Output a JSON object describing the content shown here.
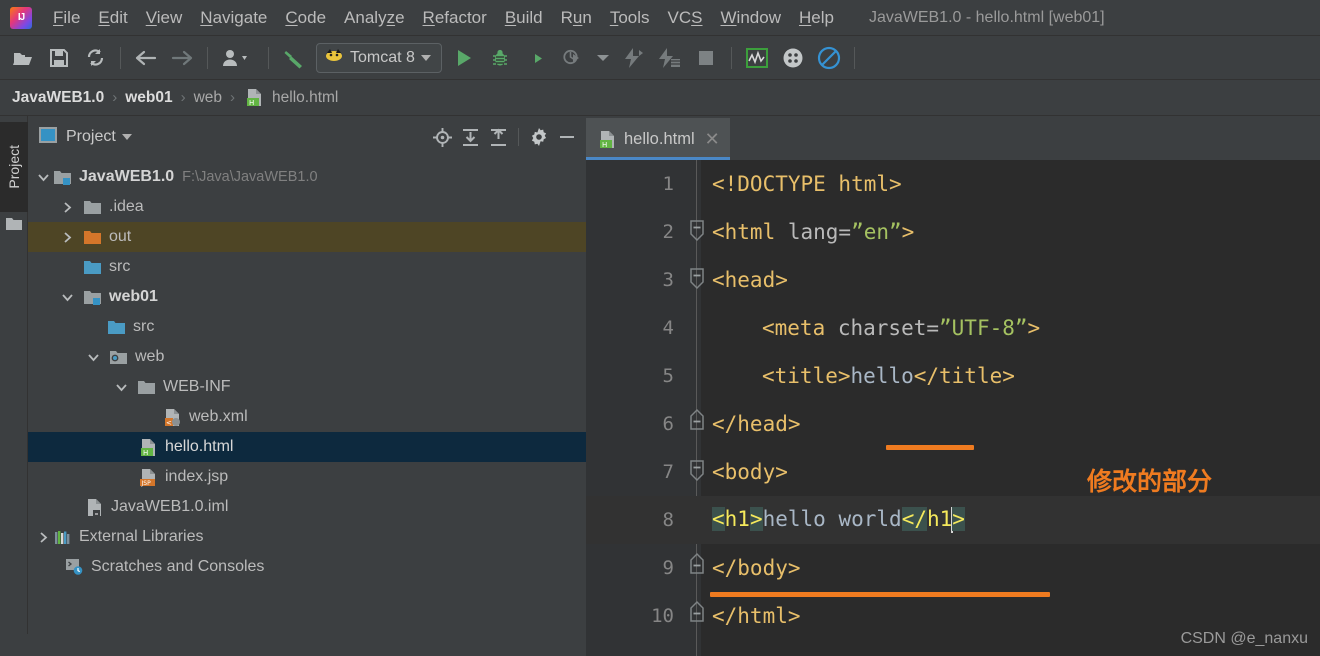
{
  "window": {
    "title": "JavaWEB1.0 - hello.html [web01]",
    "logo_icon": "intellij-idea-logo"
  },
  "menubar": {
    "items": [
      {
        "label": "File",
        "mnemonic": "F"
      },
      {
        "label": "Edit",
        "mnemonic": "E"
      },
      {
        "label": "View",
        "mnemonic": "V"
      },
      {
        "label": "Navigate",
        "mnemonic": "N"
      },
      {
        "label": "Code",
        "mnemonic": "C"
      },
      {
        "label": "Analyze",
        "mnemonic": "y"
      },
      {
        "label": "Refactor",
        "mnemonic": "R"
      },
      {
        "label": "Build",
        "mnemonic": "B"
      },
      {
        "label": "Run",
        "mnemonic": "u"
      },
      {
        "label": "Tools",
        "mnemonic": "T"
      },
      {
        "label": "VCS",
        "mnemonic": "S"
      },
      {
        "label": "Window",
        "mnemonic": "W"
      },
      {
        "label": "Help",
        "mnemonic": "H"
      }
    ]
  },
  "toolbar": {
    "buttons": [
      {
        "icon": "open-folder-icon",
        "name": "open-project-button"
      },
      {
        "icon": "save-icon",
        "name": "save-all-button"
      },
      {
        "icon": "sync-icon",
        "name": "synchronize-button"
      },
      {
        "icon": "arrow-left-icon",
        "name": "back-button"
      },
      {
        "icon": "arrow-right-icon",
        "name": "forward-button"
      },
      {
        "icon": "person-dropdown-icon",
        "name": "user-menu-button"
      },
      {
        "icon": "hammer-icon",
        "name": "build-project-button"
      }
    ],
    "run_config": {
      "label": "Tomcat 8",
      "icon": "tomcat-icon",
      "dropdown_icon": "chevron-down-icon"
    },
    "run_buttons": [
      {
        "icon": "play-icon",
        "name": "run-button"
      },
      {
        "icon": "bug-icon",
        "name": "debug-button"
      },
      {
        "icon": "coverage-icon",
        "name": "run-with-coverage-button"
      },
      {
        "icon": "profiler-icon",
        "name": "profile-button"
      },
      {
        "icon": "chevron-down-icon",
        "name": "profile-dropdown-button"
      },
      {
        "icon": "update-app-icon",
        "name": "update-application-button"
      },
      {
        "icon": "redeploy-icon",
        "name": "redeploy-button"
      },
      {
        "icon": "stop-icon",
        "name": "stop-button"
      }
    ],
    "right_buttons": [
      {
        "icon": "monitor-chart-icon",
        "name": "monitor-button"
      },
      {
        "icon": "dots-grid-icon",
        "name": "browse-button"
      },
      {
        "icon": "no-entry-icon",
        "name": "disable-button"
      }
    ]
  },
  "breadcrumb": {
    "items": [
      {
        "label": "JavaWEB1.0",
        "strong": true
      },
      {
        "label": "web01",
        "strong": true
      },
      {
        "label": "web",
        "strong": false
      },
      {
        "label": "hello.html",
        "strong": false,
        "icon": "html-file-icon"
      }
    ],
    "separator": "›"
  },
  "left_strip": {
    "tab_label": "Project",
    "icon": "folder-icon"
  },
  "project_panel": {
    "title": "Project",
    "dropdown_icon": "chevron-down-icon",
    "actions": [
      {
        "icon": "locate-target-icon",
        "name": "select-opened-file-button"
      },
      {
        "icon": "expand-all-icon",
        "name": "expand-all-button"
      },
      {
        "icon": "collapse-all-icon",
        "name": "collapse-all-button"
      },
      {
        "icon": "gear-icon",
        "name": "settings-button"
      },
      {
        "icon": "minimize-icon",
        "name": "hide-button"
      }
    ],
    "tree": [
      {
        "label": "JavaWEB1.0",
        "sublabel": "F:\\Java\\JavaWEB1.0",
        "indent": 0,
        "twisty": "expanded",
        "icon": "module-folder-icon",
        "bold": true,
        "selected": "none"
      },
      {
        "label": ".idea",
        "sublabel": "",
        "indent": 1,
        "twisty": "collapsed",
        "icon": "folder-gray-icon",
        "bold": false,
        "selected": "none"
      },
      {
        "label": "out",
        "sublabel": "",
        "indent": 1,
        "twisty": "collapsed",
        "icon": "folder-orange-icon",
        "bold": false,
        "selected": "brown"
      },
      {
        "label": "src",
        "sublabel": "",
        "indent": 1,
        "twisty": "none",
        "icon": "folder-source-icon",
        "bold": false,
        "selected": "none"
      },
      {
        "label": "web01",
        "sublabel": "",
        "indent": 1,
        "twisty": "expanded",
        "icon": "module-folder-icon",
        "bold": true,
        "selected": "none"
      },
      {
        "label": "src",
        "sublabel": "",
        "indent": 2,
        "twisty": "none",
        "icon": "folder-source-icon",
        "bold": false,
        "selected": "none"
      },
      {
        "label": "web",
        "sublabel": "",
        "indent": 2,
        "twisty": "expanded",
        "icon": "folder-web-icon",
        "bold": false,
        "selected": "none"
      },
      {
        "label": "WEB-INF",
        "sublabel": "",
        "indent": 3,
        "twisty": "expanded",
        "icon": "folder-gray-icon",
        "bold": false,
        "selected": "none"
      },
      {
        "label": "web.xml",
        "sublabel": "",
        "indent": 4,
        "twisty": "none",
        "icon": "xml-file-icon",
        "bold": false,
        "selected": "none"
      },
      {
        "label": "hello.html",
        "sublabel": "",
        "indent": 3,
        "twisty": "none",
        "icon": "html-file-icon",
        "bold": false,
        "selected": "blue"
      },
      {
        "label": "index.jsp",
        "sublabel": "",
        "indent": 3,
        "twisty": "none",
        "icon": "jsp-file-icon",
        "bold": false,
        "selected": "none"
      },
      {
        "label": "JavaWEB1.0.iml",
        "sublabel": "",
        "indent": 1,
        "twisty": "none",
        "icon": "iml-file-icon",
        "bold": false,
        "selected": "none"
      },
      {
        "label": "External Libraries",
        "sublabel": "",
        "indent": 0,
        "twisty": "collapsed",
        "icon": "libraries-icon",
        "bold": false,
        "selected": "none"
      },
      {
        "label": "Scratches and Consoles",
        "sublabel": "",
        "indent": 0,
        "twisty": "none",
        "icon": "scratches-icon",
        "bold": false,
        "selected": "none"
      }
    ]
  },
  "editor": {
    "tab": {
      "label": "hello.html",
      "icon": "html-file-icon",
      "close_icon": "close-icon"
    },
    "lines": [
      {
        "num": "1",
        "fold": "none",
        "caret_line": false
      },
      {
        "num": "2",
        "fold": "open",
        "caret_line": false
      },
      {
        "num": "3",
        "fold": "open",
        "caret_line": false
      },
      {
        "num": "4",
        "fold": "none",
        "caret_line": false
      },
      {
        "num": "5",
        "fold": "none",
        "caret_line": false
      },
      {
        "num": "6",
        "fold": "close",
        "caret_line": false
      },
      {
        "num": "7",
        "fold": "open",
        "caret_line": false
      },
      {
        "num": "8",
        "fold": "none",
        "caret_line": true
      },
      {
        "num": "9",
        "fold": "close",
        "caret_line": false
      },
      {
        "num": "10",
        "fold": "close",
        "caret_line": false
      }
    ],
    "code": {
      "l1_tag": "<!DOCTYPE html>",
      "l2_a": "<html",
      "l2_b": " lang=",
      "l2_c": "”en”",
      "l2_d": ">",
      "l3": "<head>",
      "l4_a": "<meta",
      "l4_b": " charset=",
      "l4_c": "”UTF-8”",
      "l4_d": ">",
      "l5_a": "<title>",
      "l5_b": "hello",
      "l5_c": "</title>",
      "l6": "</head>",
      "l7": "<body>",
      "l8_lt": "<",
      "l8_name": "h1",
      "l8_gt": ">",
      "l8_text": "hello world",
      "l8_clt": "</",
      "l8_cname": "h1",
      "l8_cgt": ">",
      "l9": "</body>",
      "l10": "</html>"
    }
  },
  "annotations": {
    "note_text": "修改的部分",
    "accent_color": "#ef7b20"
  },
  "watermark": {
    "text": "CSDN @e_nanxu"
  }
}
